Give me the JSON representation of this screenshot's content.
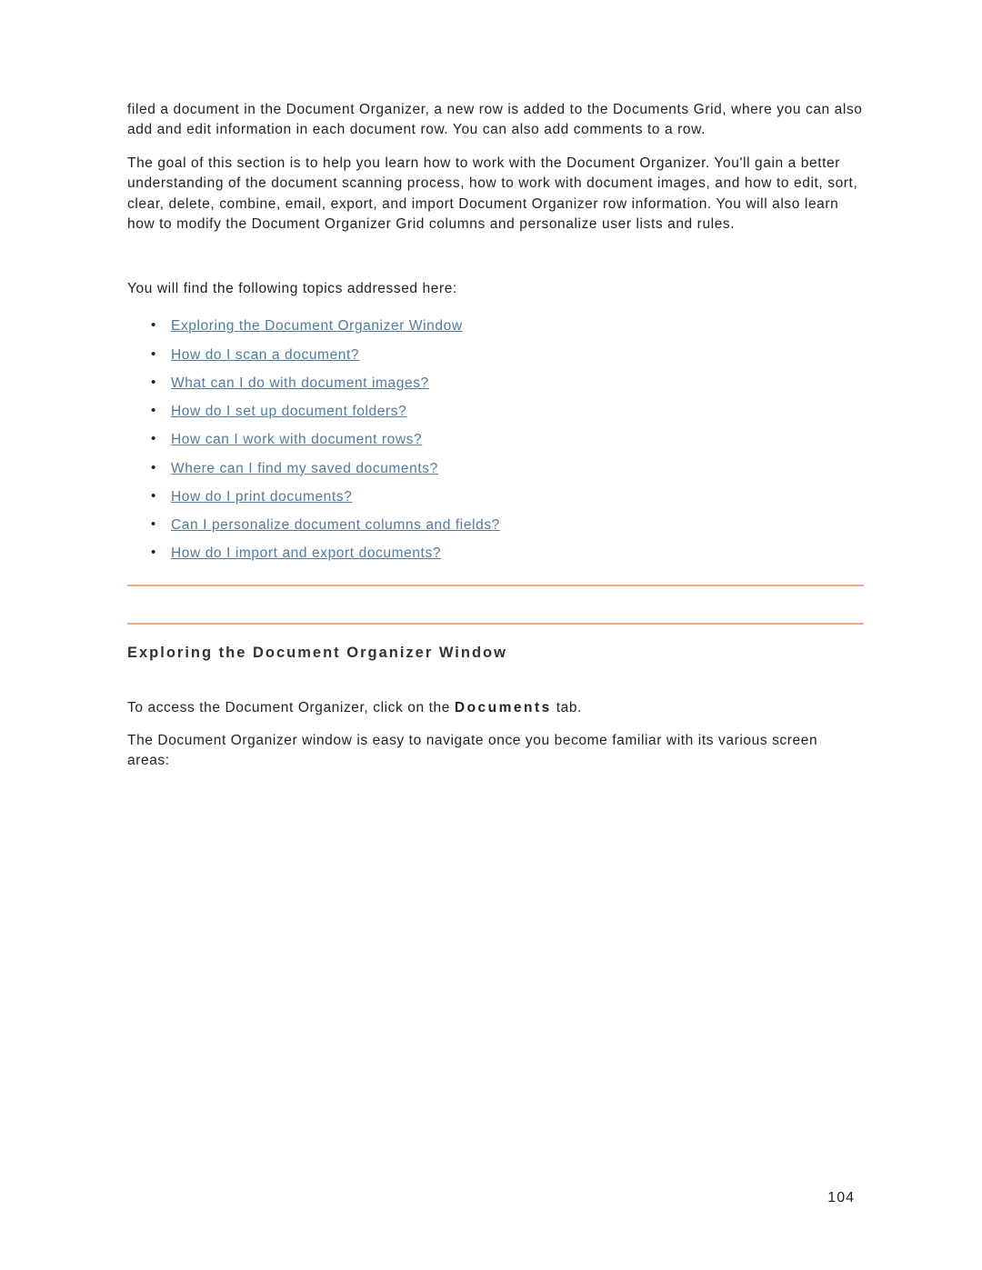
{
  "intro": {
    "para1": "filed a document in the Document Organizer, a new row is added to the Documents Grid, where you can also add and edit information in each document row. You can also add comments to a row.",
    "para2": "The goal of this section is to help you learn how to work with the Document Organizer. You'll gain a better understanding of the document scanning process, how to work with document images, and how to edit, sort, clear, delete, combine, email, export, and import Document Organizer row information. You will also learn how to modify the Document Organizer Grid columns and personalize user lists and rules.",
    "topics_intro": "You will find the following topics addressed here:"
  },
  "topics": [
    "Exploring the Document Organizer Window",
    "How do I scan a document?",
    "What can I do with document images?",
    "How do I set up document folders?",
    "How can I work with document rows?",
    "Where can I find my saved documents?",
    "How do I print documents?",
    "Can I personalize document columns and fields?",
    "How do I import and export documents?"
  ],
  "section": {
    "heading": "Exploring the Document Organizer Window",
    "access_prefix": "To access the Document Organizer, click on the ",
    "access_bold": "Documents",
    "access_suffix": " tab.",
    "navigate": "The Document Organizer window is easy to navigate once you become familiar with its various screen areas:"
  },
  "page_number": "104"
}
